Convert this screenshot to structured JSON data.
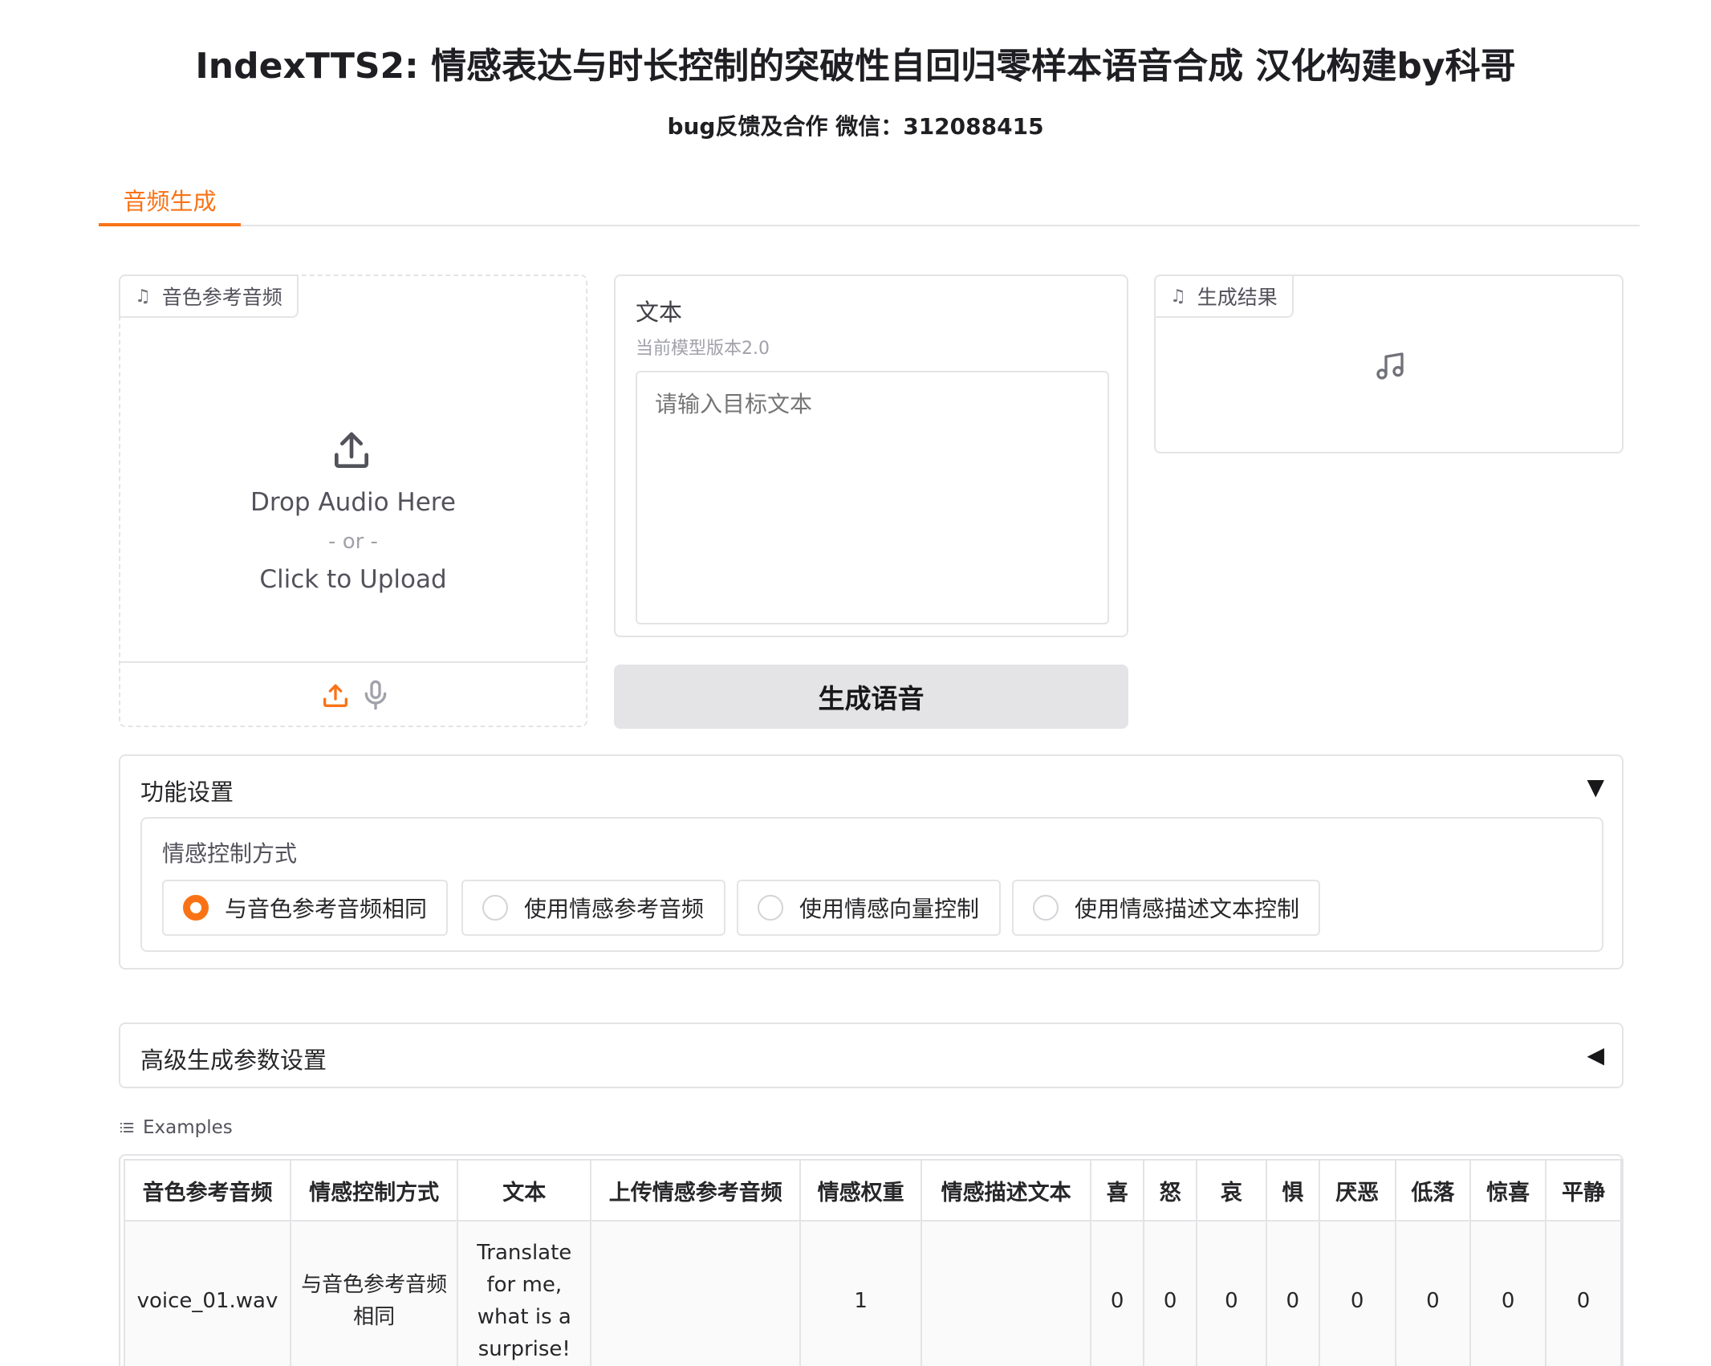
{
  "header": {
    "title": "IndexTTS2: 情感表达与时长控制的突破性自回归零样本语音合成 汉化构建by科哥",
    "subtitle": "bug反馈及合作 微信：312088415"
  },
  "tabs": [
    {
      "label": "音频生成"
    }
  ],
  "ref_audio": {
    "label": "音色参考音频",
    "drop_text": "Drop Audio Here",
    "or_text": "- or -",
    "click_text": "Click to Upload"
  },
  "text_input": {
    "label": "文本",
    "info": "当前模型版本2.0",
    "placeholder": "请输入目标文本"
  },
  "generate_button": {
    "label": "生成语音"
  },
  "result": {
    "label": "生成结果"
  },
  "function_settings": {
    "title": "功能设置",
    "arrow": "▼",
    "emotion_mode_label": "情感控制方式",
    "options": [
      {
        "label": "与音色参考音频相同",
        "selected": true
      },
      {
        "label": "使用情感参考音频",
        "selected": false
      },
      {
        "label": "使用情感向量控制",
        "selected": false
      },
      {
        "label": "使用情感描述文本控制",
        "selected": false
      }
    ]
  },
  "advanced_settings": {
    "title": "高级生成参数设置",
    "arrow": "◀"
  },
  "examples": {
    "label": "Examples",
    "headers": [
      "音色参考音频",
      "情感控制方式",
      "文本",
      "上传情感参考音频",
      "情感权重",
      "情感描述文本",
      "喜",
      "怒",
      "哀",
      "惧",
      "厌恶",
      "低落",
      "惊喜",
      "平静"
    ],
    "rows": [
      [
        "voice_01.wav",
        "与音色参考音频相同",
        "Translate for me, what is a surprise!",
        "",
        "1",
        "",
        "0",
        "0",
        "0",
        "0",
        "0",
        "0",
        "0",
        "0"
      ]
    ]
  },
  "colors": {
    "accent": "#f97316",
    "border": "#e4e4e7",
    "button_bg": "#e4e4e7"
  }
}
